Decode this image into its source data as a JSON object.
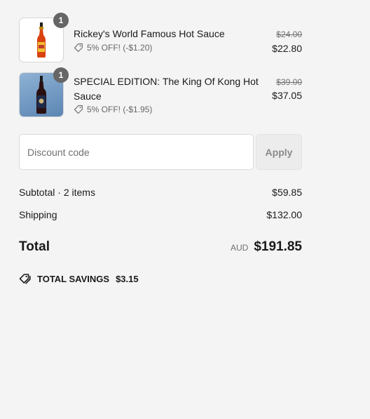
{
  "items": [
    {
      "name": "Rickey's World Famous Hot Sauce",
      "quantity": "1",
      "discount": "5% OFF! (-$1.20)",
      "original_price": "$24.00",
      "price": "$22.80",
      "icon": "tag-icon"
    },
    {
      "name": "SPECIAL EDITION: The King Of Kong Hot Sauce",
      "quantity": "1",
      "discount": "5% OFF! (-$1.95)",
      "original_price": "$39.00",
      "price": "$37.05",
      "icon": "tag-icon"
    }
  ],
  "discount": {
    "placeholder": "Discount code",
    "apply_label": "Apply"
  },
  "subtotal": {
    "label": "Subtotal · 2 items",
    "value": "$59.85"
  },
  "shipping": {
    "label": "Shipping",
    "value": "$132.00"
  },
  "total": {
    "label": "Total",
    "currency": "AUD",
    "value": "$191.85"
  },
  "savings": {
    "label": "TOTAL SAVINGS",
    "value": "$3.15",
    "icon": "tags-icon"
  },
  "colors": {
    "background": "#f4f4f4",
    "badge": "#666666",
    "text": "#1a1a1a",
    "muted": "#707070"
  }
}
